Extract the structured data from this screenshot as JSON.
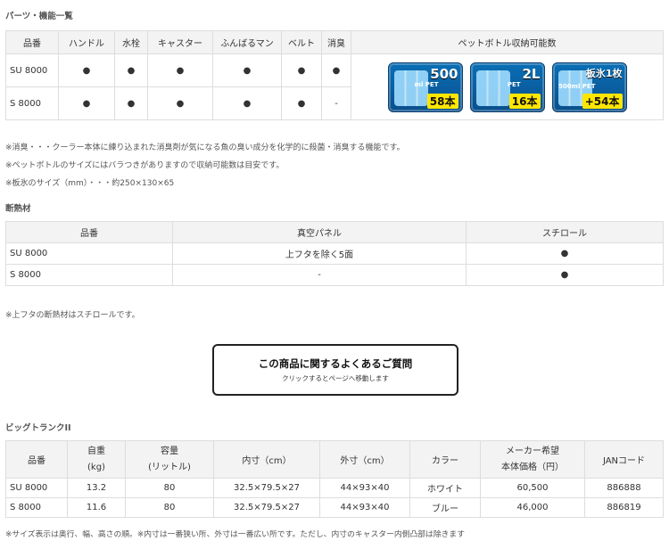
{
  "parts": {
    "title": "パーツ・機能一覧",
    "headers": [
      "品番",
      "ハンドル",
      "水栓",
      "キャスター",
      "ふんばるマン",
      "ベルト",
      "消臭",
      "ペットボトル収納可能数"
    ],
    "rows": [
      {
        "model": "SU 8000",
        "cells": [
          "●",
          "●",
          "●",
          "●",
          "●",
          "●"
        ]
      },
      {
        "model": "S 8000",
        "cells": [
          "●",
          "●",
          "●",
          "●",
          "●",
          "-"
        ]
      }
    ],
    "badges": [
      {
        "big": "500",
        "unit": "ml PET",
        "qty": "58本"
      },
      {
        "big": "2L",
        "unit": "PET",
        "qty": "16本"
      },
      {
        "big": "板氷1枚",
        "unit": "500ml PET",
        "qty": "+54本"
      }
    ],
    "notes": [
      "※消臭・・・クーラー本体に練り込まれた消臭剤が気になる魚の臭い成分を化学的に殺菌・消臭する機能です。",
      "※ペットボトルのサイズにはバラつきがありますので収納可能数は目安です。",
      "※板氷のサイズ（mm）・・・約250×130×65"
    ]
  },
  "insulation": {
    "title": "断熱材",
    "headers": [
      "品番",
      "真空パネル",
      "スチロール"
    ],
    "rows": [
      {
        "model": "SU 8000",
        "vacuum": "上フタを除く5面",
        "styrol": "●"
      },
      {
        "model": "S 8000",
        "vacuum": "-",
        "styrol": "●"
      }
    ],
    "note": "※上フタの断熱材はスチロールです。"
  },
  "faq": {
    "title": "この商品に関するよくあるご質問",
    "sub": "クリックするとページへ移動します"
  },
  "specs": {
    "title": "ビッグトランクII",
    "headers": [
      [
        "品番"
      ],
      [
        "自重",
        "(kg)"
      ],
      [
        "容量",
        "(リットル)"
      ],
      [
        "内寸（cm）"
      ],
      [
        "外寸（cm）"
      ],
      [
        "カラー"
      ],
      [
        "メーカー希望",
        "本体価格（円）"
      ],
      [
        "JANコード"
      ]
    ],
    "rows": [
      [
        "SU 8000",
        "13.2",
        "80",
        "32.5×79.5×27",
        "44×93×40",
        "ホワイト",
        "60,500",
        "886888"
      ],
      [
        "S 8000",
        "11.6",
        "80",
        "32.5×79.5×27",
        "44×93×40",
        "ブルー",
        "46,000",
        "886819"
      ]
    ],
    "note": "※サイズ表示は奥行、幅、高さの順。※内寸は一番狭い所、外寸は一番広い所です。ただし、内寸のキャスター内側凸部は除きます"
  }
}
